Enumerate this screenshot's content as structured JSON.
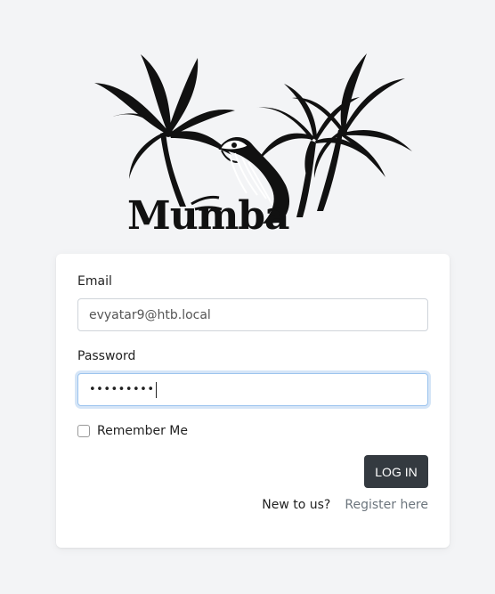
{
  "brand": {
    "logo_text": "Mumba"
  },
  "form": {
    "email_label": "Email",
    "email_value": "evyatar9@htb.local",
    "password_label": "Password",
    "password_display": "•••••••••",
    "remember_label": "Remember Me",
    "login_button": "LOG IN",
    "new_to_us": "New to us?",
    "register_link": "Register here"
  },
  "colors": {
    "page_background": "#f3f4f6",
    "button_background": "#343a40",
    "link": "#6c757d",
    "focus_ring": "#9cc4ee"
  }
}
